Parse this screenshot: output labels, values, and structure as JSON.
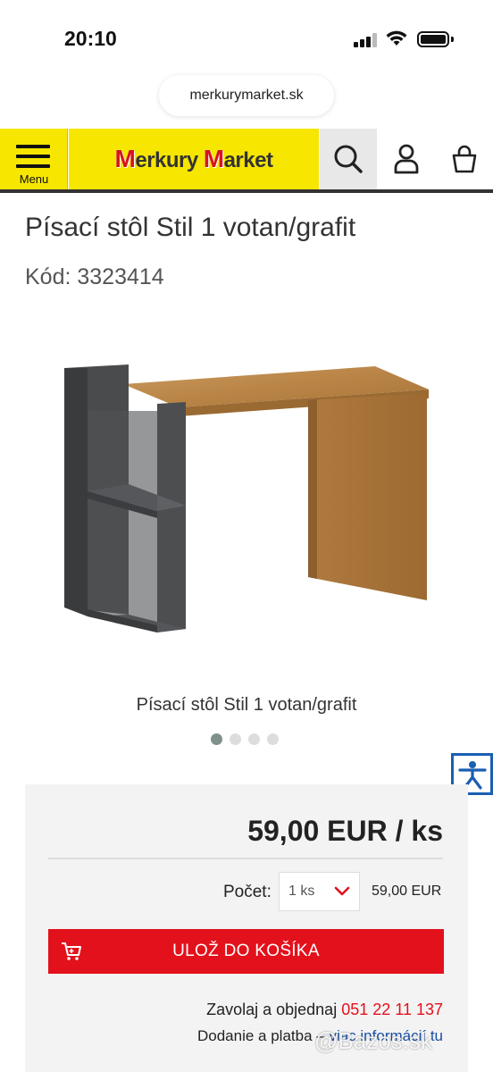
{
  "status_bar": {
    "time": "20:10"
  },
  "browser": {
    "url": "merkurymarket.sk"
  },
  "header": {
    "menu_label": "Menu",
    "logo_text_1": "erkury",
    "logo_text_2": "arket",
    "logo_mark": "M"
  },
  "product": {
    "title": "Písací stôl Stil 1 votan/grafit",
    "code": "Kód: 3323414",
    "caption": "Písací stôl Stil 1 votan/grafit",
    "gallery_count": 4,
    "gallery_active_index": 0
  },
  "purchase": {
    "price": "59,00 EUR / ks",
    "qty_label": "Počet:",
    "qty_value": "1 ks",
    "qty_total": "59,00 EUR",
    "add_to_cart": "ULOŽ DO KOŠÍKA",
    "call_text": "Zavolaj a objednaj",
    "phone": "051 22 11 137",
    "delivery_text": "Dodanie a platba –",
    "delivery_link": "viac informácií tu"
  },
  "watermark": "@Bazos.sk",
  "colors": {
    "brand_yellow": "#f6e600",
    "brand_red": "#e3111b",
    "link_blue": "#1a4fa0"
  },
  "icons": [
    "menu-icon",
    "search-icon",
    "user-icon",
    "cart-icon",
    "chevron-down-icon",
    "accessibility-icon",
    "add-to-cart-icon",
    "wifi-icon",
    "signal-icon",
    "battery-icon"
  ]
}
